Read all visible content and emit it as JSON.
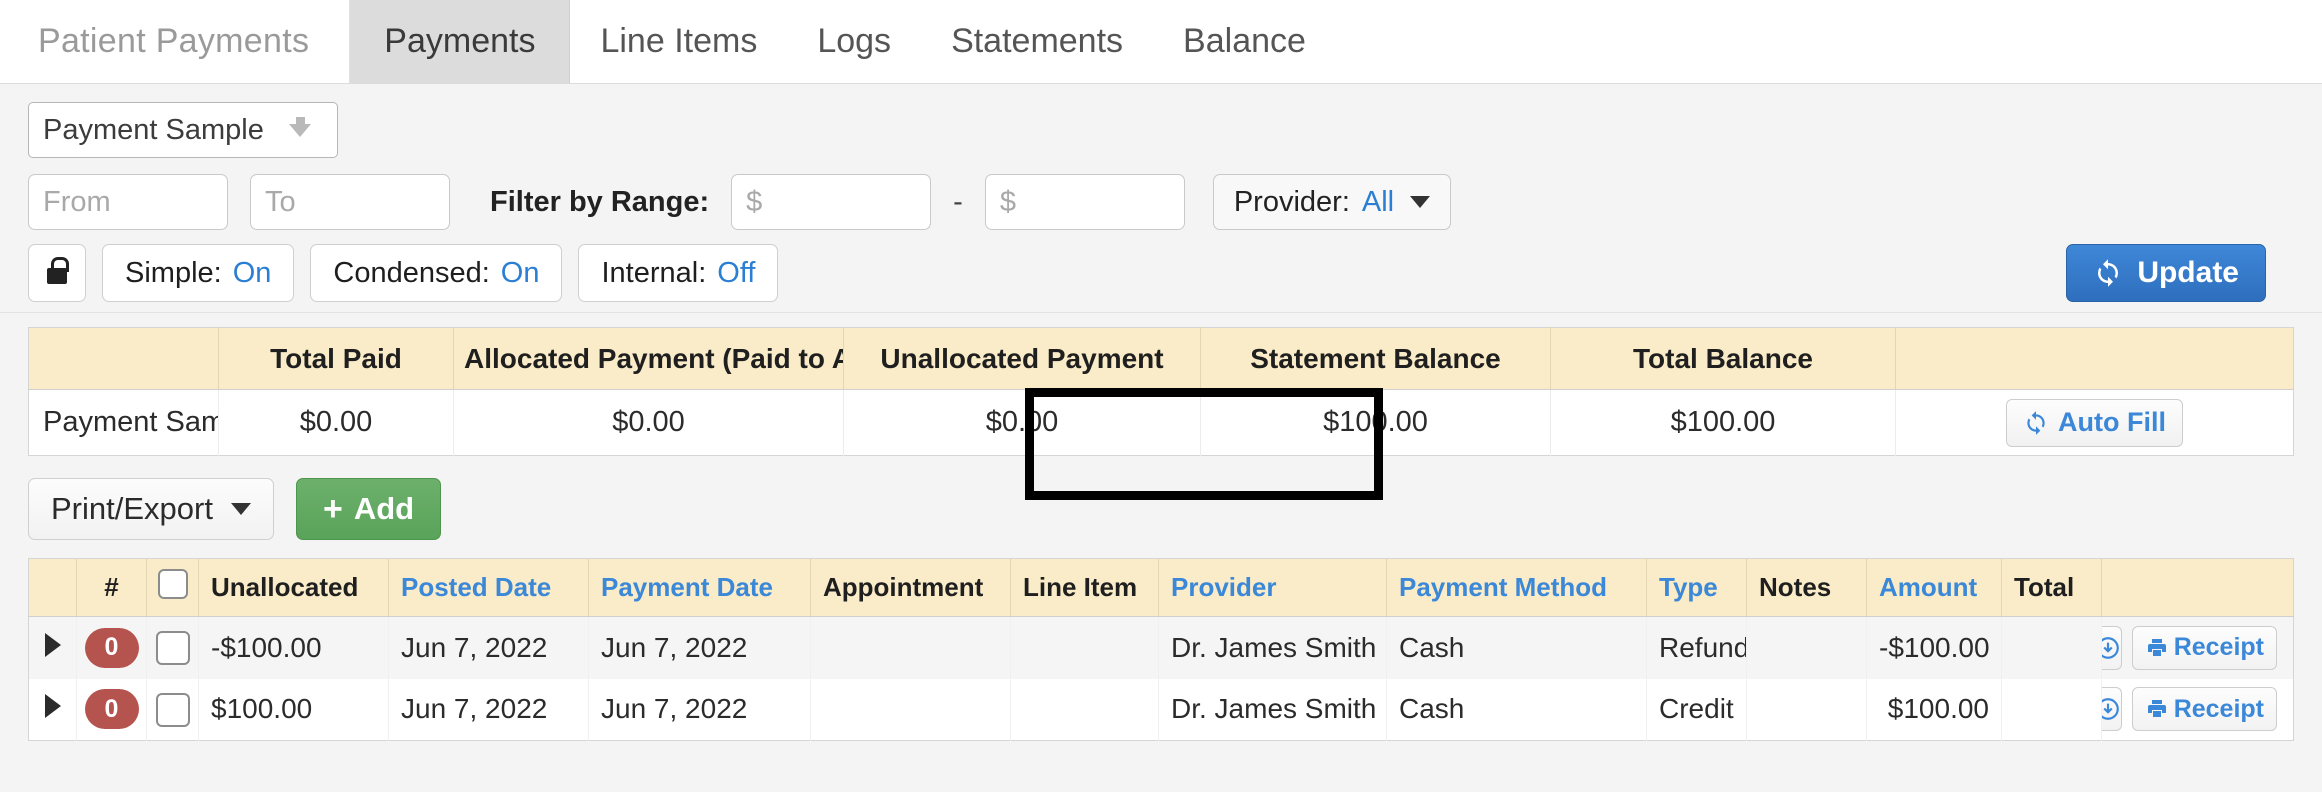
{
  "header": {
    "title": "Patient Payments",
    "tabs": [
      {
        "label": "Payments",
        "active": true
      },
      {
        "label": "Line Items",
        "active": false
      },
      {
        "label": "Logs",
        "active": false
      },
      {
        "label": "Statements",
        "active": false
      },
      {
        "label": "Balance",
        "active": false
      }
    ]
  },
  "filters": {
    "account_select": "Payment Sample",
    "from_placeholder": "From",
    "to_placeholder": "To",
    "from_value": "",
    "to_value": "",
    "range_label": "Filter by Range:",
    "range_min_placeholder": "$",
    "range_max_placeholder": "$",
    "range_min_value": "",
    "range_max_value": "",
    "range_separator": "-",
    "provider_label": "Provider:",
    "provider_value": "All"
  },
  "toggles": {
    "lock_icon": "lock-icon",
    "simple_label": "Simple:",
    "simple_value": "On",
    "condensed_label": "Condensed:",
    "condensed_value": "On",
    "internal_label": "Internal:",
    "internal_value": "Off",
    "update_label": "Update"
  },
  "summary": {
    "columns": [
      "",
      "Total Paid",
      "Allocated Payment (Paid to Appt)",
      "Unallocated Payment",
      "Statement Balance",
      "Total Balance",
      ""
    ],
    "highlighted_column": "Unallocated Payment",
    "row": {
      "name": "Payment Sample",
      "total_paid": "$0.00",
      "allocated_payment": "$0.00",
      "unallocated_payment": "$0.00",
      "statement_balance": "$100.00",
      "total_balance": "$100.00",
      "action_label": "Auto Fill"
    }
  },
  "actions": {
    "print_export_label": "Print/Export",
    "add_label": "Add"
  },
  "grid": {
    "columns": [
      {
        "label": "",
        "link": false
      },
      {
        "label": "#",
        "link": false
      },
      {
        "label": "",
        "link": false
      },
      {
        "label": "Unallocated",
        "link": false
      },
      {
        "label": "Posted Date",
        "link": true
      },
      {
        "label": "Payment Date",
        "link": true
      },
      {
        "label": "Appointment",
        "link": false
      },
      {
        "label": "Line Item",
        "link": false
      },
      {
        "label": "Provider",
        "link": true
      },
      {
        "label": "Payment Method",
        "link": true
      },
      {
        "label": "Type",
        "link": true
      },
      {
        "label": "Notes",
        "link": false
      },
      {
        "label": "Amount",
        "link": true
      },
      {
        "label": "Total",
        "link": false
      },
      {
        "label": "",
        "link": false
      }
    ],
    "rows": [
      {
        "badge": "0",
        "unallocated": "-$100.00",
        "posted_date": "Jun 7, 2022",
        "payment_date": "Jun 7, 2022",
        "appointment": "",
        "line_item": "",
        "provider": "Dr. James Smith",
        "payment_method": "Cash",
        "type": "Refund",
        "notes": "",
        "amount": "-$100.00",
        "total": "",
        "receipt_label": "Receipt"
      },
      {
        "badge": "0",
        "unallocated": "$100.00",
        "posted_date": "Jun 7, 2022",
        "payment_date": "Jun 7, 2022",
        "appointment": "",
        "line_item": "",
        "provider": "Dr. James Smith",
        "payment_method": "Cash",
        "type": "Credit",
        "notes": "",
        "amount": "$100.00",
        "total": "",
        "receipt_label": "Receipt"
      }
    ]
  },
  "colors": {
    "table_header_bg": "#faecc8",
    "link_blue": "#3b87d8",
    "primary_button": "#2e6fbd",
    "add_button_green": "#5aa35a",
    "badge_red": "#b5534f",
    "highlight_border": "#000000"
  }
}
